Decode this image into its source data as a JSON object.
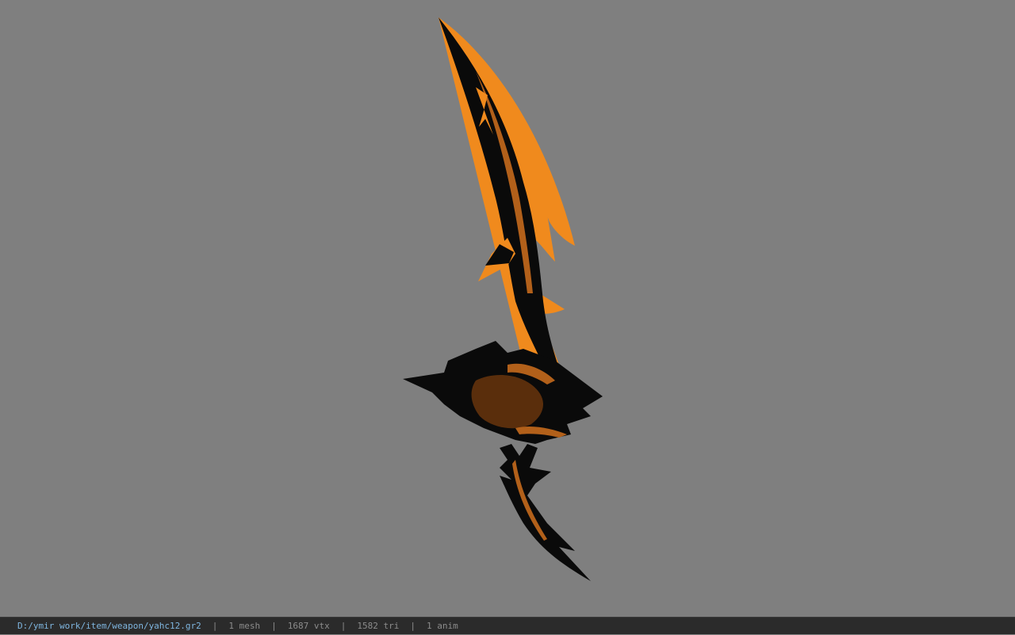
{
  "viewer": {
    "background": "#7f7f7f",
    "model_colors": {
      "primary": "#f08a1d",
      "shadow": "#0a0a0a",
      "accent": "#b2601a"
    }
  },
  "statusbar": {
    "file_path": "D:/ymir work/item/weapon/yahc12.gr2",
    "mesh_count": "1 mesh",
    "vertex_count": "1687 vtx",
    "triangle_count": "1582 tri",
    "anim_count": "1 anim",
    "separator": "|"
  }
}
